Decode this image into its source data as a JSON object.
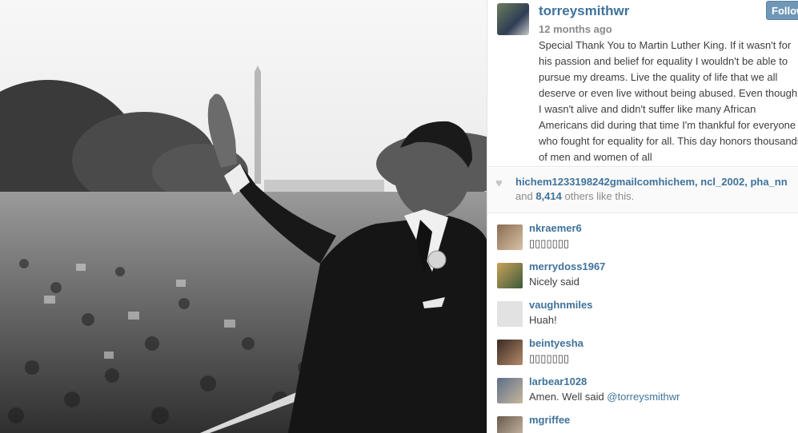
{
  "post": {
    "username": "torreysmithwr",
    "time_ago": "12 months ago",
    "follow_label": "Follow",
    "caption": "Special Thank You to Martin Luther King. If it wasn't for his passion and belief for equality I wouldn't be able to pursue my dreams. Live the quality of life that we all deserve or even live without being abused. Even though I wasn't alive and didn't suffer like many African Americans did during that time I'm thankful for everyone who fought for equality for all. This day honors thousands of men and women of all"
  },
  "likes": {
    "likers": [
      "hichem1233198242gmailcomhichem",
      "ncl_2002",
      "pha_nn"
    ],
    "separator": ",",
    "prefix": "and",
    "count": "8,414",
    "suffix": "others like this."
  },
  "comments": [
    {
      "user": "nkraemer6",
      "text": "▯▯▯▯▯▯▯",
      "mention": ""
    },
    {
      "user": "merrydoss1967",
      "text": "Nicely said",
      "mention": ""
    },
    {
      "user": "vaughnmiles",
      "text": "Huah!",
      "mention": ""
    },
    {
      "user": "beintyesha",
      "text": "▯▯▯▯▯▯▯",
      "mention": ""
    },
    {
      "user": "larbear1028",
      "text": "Amen. Well said ",
      "mention": "@torreysmithwr"
    },
    {
      "user": "mgriffee",
      "text": "",
      "mention": ""
    }
  ],
  "colors": {
    "link": "#3f729b",
    "follow_button": "#6f97b6",
    "muted_text": "#8a8a8a"
  },
  "icons": {
    "like": "heart-icon"
  }
}
